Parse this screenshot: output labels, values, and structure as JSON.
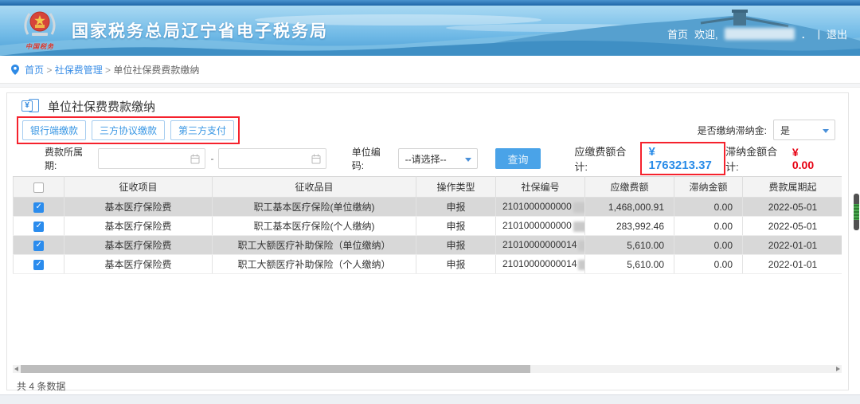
{
  "header": {
    "title": "国家税务总局辽宁省电子税务局",
    "logo_caption": "中国税务",
    "nav": {
      "home": "首页",
      "welcome": "欢迎,",
      "dot": "．",
      "separator": "|",
      "logout": "退出"
    }
  },
  "breadcrumb": {
    "separator": ">",
    "items": [
      "首页",
      "社保费管理",
      "单位社保费费款缴纳"
    ]
  },
  "page": {
    "title": "单位社保费费款缴纳",
    "action_buttons": [
      "银行端缴款",
      "三方协议缴款",
      "第三方支付"
    ],
    "filters": {
      "late_fee_label": "是否缴纳滞纳金:",
      "late_fee_value": "是",
      "period_label": "费款所属期:",
      "range_separator": "-",
      "unit_code_label": "单位编码:",
      "unit_code_value": "--请选择--",
      "search_button": "查询"
    },
    "summary": {
      "payable_label": "应缴费额合计:",
      "payable_value": "¥ 1763213.37",
      "late_label": "滞纳金额合计:",
      "late_value": "¥ 0.00"
    }
  },
  "table": {
    "columns": [
      "征收项目",
      "征收品目",
      "操作类型",
      "社保编号",
      "应缴费额",
      "滞纳金额",
      "费款属期起"
    ],
    "rows": [
      {
        "checked": true,
        "project": "基本医疗保险费",
        "item": "职工基本医疗保险(单位缴纳)",
        "op": "申报",
        "ssn": "2101000000000",
        "ssn_redacted": true,
        "payable": "1,468,000.91",
        "late": "0.00",
        "start": "2022-05-01"
      },
      {
        "checked": true,
        "project": "基本医疗保险费",
        "item": "职工基本医疗保险(个人缴纳)",
        "op": "申报",
        "ssn": "2101000000000",
        "ssn_redacted": true,
        "payable": "283,992.46",
        "late": "0.00",
        "start": "2022-05-01"
      },
      {
        "checked": true,
        "project": "基本医疗保险费",
        "item": "职工大额医疗补助保险（单位缴纳）",
        "op": "申报",
        "ssn": "21010000000014",
        "ssn_redacted": true,
        "payable": "5,610.00",
        "late": "0.00",
        "start": "2022-01-01"
      },
      {
        "checked": true,
        "project": "基本医疗保险费",
        "item": "职工大额医疗补助保险（个人缴纳）",
        "op": "申报",
        "ssn": "21010000000014",
        "ssn_redacted": true,
        "payable": "5,610.00",
        "late": "0.00",
        "start": "2022-01-01"
      }
    ],
    "footer_count": "共 4 条数据"
  },
  "colors": {
    "accent_blue": "#2b8ced",
    "link_blue": "#3a8ee6",
    "summary_blue": "#2a8ce8",
    "danger_red": "#e60012",
    "annotation_red": "#f5222d",
    "button_blue": "#4aa3e8",
    "stripe_gray": "#d8d8d8"
  }
}
